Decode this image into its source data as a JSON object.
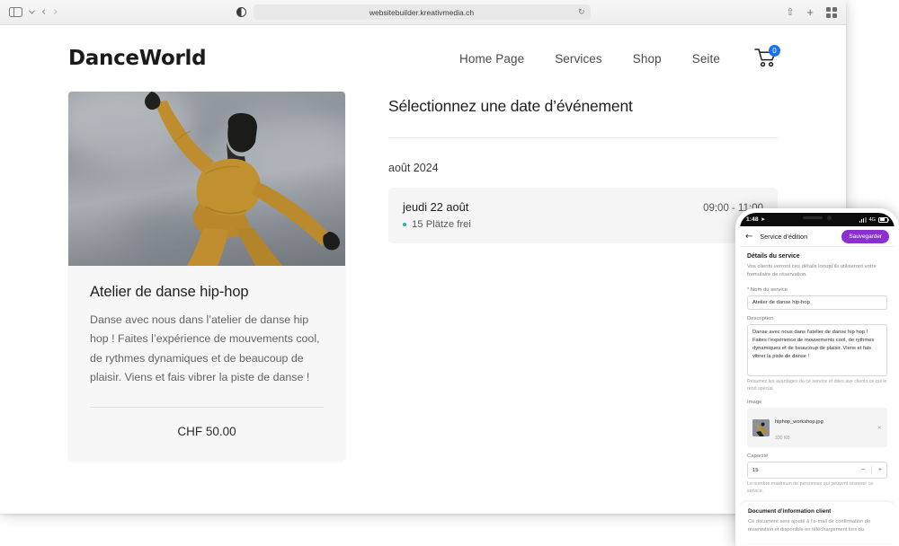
{
  "browser": {
    "url": "websitebuilder.kreativmedia.ch",
    "sidebar_icon": "sidebar-toggle-icon",
    "back_label": "‹",
    "forward_label": "›",
    "reload_label": "↻",
    "share_label": "⇧",
    "newtab_label": "+",
    "tabs_label": "tab-overview-icon"
  },
  "site": {
    "brand": "DanceWorld",
    "nav": [
      {
        "label": "Home Page"
      },
      {
        "label": "Services"
      },
      {
        "label": "Shop"
      },
      {
        "label": "Seite"
      }
    ],
    "cart": {
      "badge": "0"
    },
    "product": {
      "title": "Atelier de danse hip-hop",
      "description": "Danse avec nous dans l’atelier de danse hip hop ! Faites l’expérience de mouvements cool, de rythmes dynamiques et de beaucoup de plaisir. Viens et fais vibrer la piste de danse !",
      "price": "CHF 50.00"
    },
    "booking": {
      "title": "Sélectionnez une date d’événement",
      "month": "août 2024",
      "slots": [
        {
          "date": "jeudi 22 août",
          "time": "09:00 - 11:00",
          "availability": "15 Plätze frei"
        }
      ]
    }
  },
  "phone": {
    "status": {
      "time": "1:48",
      "location_icon": "➤",
      "network": "4G"
    },
    "appbar": {
      "back_icon": "←",
      "title": "Service d’édition",
      "save_label": "Sauvegarder"
    },
    "form": {
      "section_title": "Détails du service",
      "section_sub": "Vos clients verront ces détails lorsqu’ils utiliseront votre formulaire de réservation.",
      "name_label": "* Nom du service",
      "name_value": "Atelier de danse hip-hop",
      "description_label": "Description",
      "description_value": "Danse avec nous dans l’atelier de danse hip hop ! Faites l’expérience de mouvements cool, de rythmes dynamiques et de beaucoup de plaisir. Viens et fais vibrer la piste de danse !",
      "description_helper": "Résumez les avantages de ce service et dites aux clients ce qui le rend spécial.",
      "image_label": "Image",
      "image_name": "hiphop_workshop.jpg",
      "image_size": "330 KB",
      "image_remove": "×",
      "capacity_label": "Capacité",
      "capacity_value": "15",
      "capacity_minus": "−",
      "capacity_plus": "+",
      "capacity_helper": "Le nombre maximum de personnes qui peuvent réserver ce service.",
      "doc_title": "Document d’information client",
      "doc_sub": "Ce document sera ajouté à l’e-mail de confirmation de réservation et disponible en téléchargement lors du"
    }
  },
  "colors": {
    "accent_purple": "#8B2FD0",
    "cart_badge_blue": "#1a73e8",
    "availability_teal": "#2ab0a3"
  }
}
